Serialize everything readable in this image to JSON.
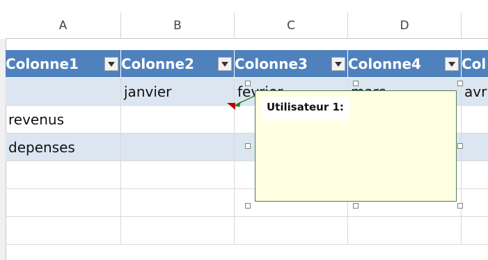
{
  "columns": [
    "A",
    "B",
    "C",
    "D"
  ],
  "table": {
    "headers": [
      "Colonne1",
      "Colonne2",
      "Colonne3",
      "Colonne4",
      "Col"
    ],
    "rows": [
      [
        "",
        "janvier",
        "fevrier",
        "mars",
        "avr"
      ],
      [
        "revenus",
        "",
        "",
        "",
        ""
      ],
      [
        "depenses",
        "",
        "",
        "",
        ""
      ],
      [
        "",
        "",
        "",
        "",
        ""
      ],
      [
        "",
        "",
        "",
        "",
        ""
      ],
      [
        "",
        "",
        "",
        "",
        ""
      ]
    ]
  },
  "comment": {
    "author": "Utilisateur 1:",
    "text": ""
  },
  "colors": {
    "header_bg": "#4f81bd",
    "band_bg": "#dce6f1",
    "comment_bg": "#ffffe1",
    "comment_border": "#4b7a4b"
  },
  "icons": {
    "filter": "filter-dropdown-arrow",
    "comment_indicator": "red-triangle"
  }
}
